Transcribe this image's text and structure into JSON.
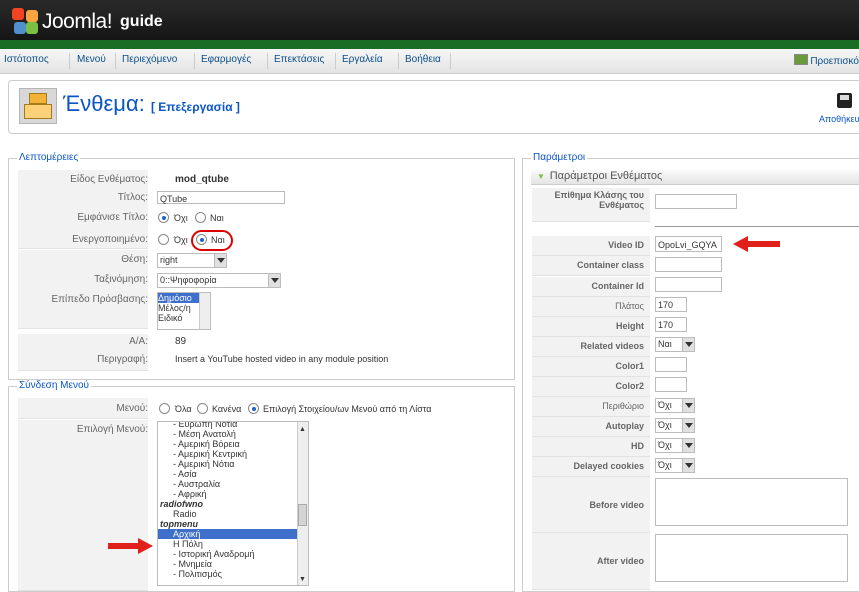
{
  "app": {
    "logo_text": "Joomla!",
    "site_name": "guide"
  },
  "menu": {
    "items": [
      "Ιστότοπος",
      "Μενού",
      "Περιεχόμενο",
      "Εφαρμογές",
      "Επεκτάσεις",
      "Εργαλεία",
      "Βοήθεια"
    ],
    "preview": "Προεπισκό"
  },
  "header": {
    "title": "Ένθεμα:",
    "subtitle": "[ Επεξεργασία ]",
    "save_label": "Αποθήκευ"
  },
  "details": {
    "legend": "Λεπτομέρειες",
    "type_label": "Είδος Ενθέματος:",
    "type_value": "mod_qtube",
    "title_label": "Τίτλος:",
    "title_value": "QTube",
    "show_title_label": "Εμφάνισε Τίτλο:",
    "show_title_options": [
      "Όχι",
      "Ναι"
    ],
    "show_title_selected": "Όχι",
    "enabled_label": "Ενεργοποιημένο:",
    "enabled_options": [
      "Όχι",
      "Ναι"
    ],
    "enabled_selected": "Ναι",
    "position_label": "Θέση:",
    "position_value": "right",
    "order_label": "Ταξινόμηση:",
    "order_value": "0::Ψηφοφορία",
    "access_label": "Επίπεδο Πρόσβασης:",
    "access_options": [
      "Δημόσιο",
      "Μέλος/η",
      "Ειδικό"
    ],
    "access_selected": "Δημόσιο",
    "id_label": "Α/Α:",
    "id_value": "89",
    "desc_label": "Περιγραφή:",
    "desc_value": "Insert a YouTube hosted video in any module position"
  },
  "menu_assignment": {
    "legend": "Σύνδεση Μενού",
    "menus_label": "Μενού:",
    "menus_options": [
      "Όλα",
      "Κανένα",
      "Επιλογή Στοιχείου/ων Μενού από τη Λίστα"
    ],
    "menus_selected": "Επιλογή Στοιχείου/ων Μενού από τη Λίστα",
    "select_label": "Επιλογή Μενού:",
    "list": [
      "- Ευρώπη Νότια",
      "- Μέση Ανατολή",
      "- Αμερική Βόρεια",
      "- Αμερική Κεντρική",
      "- Αμερική Νότια",
      "- Ασία",
      "- Αυστραλία",
      "- Αφρική",
      "radiofwno",
      "Radio",
      "topmenu",
      "Αρχική",
      "Η Πόλη",
      "- Ιστορική Αναδρομή",
      "- Μνημεία",
      "- Πολιτισμός"
    ],
    "list_selected": "Αρχική"
  },
  "params": {
    "legend": "Παράμετροι",
    "section_title": "Παράμετροι Ενθέματος",
    "rows": [
      {
        "label": "Επίθημα Κλάσης του Ενθέματος",
        "value": ""
      },
      {
        "label": "Video ID",
        "value": "OpoLvi_GQYA"
      },
      {
        "label": "Container class",
        "value": ""
      },
      {
        "label": "Container Id",
        "value": ""
      },
      {
        "label": "Πλάτος",
        "value": "170"
      },
      {
        "label": "Height",
        "value": "170"
      },
      {
        "label": "Related videos",
        "value": "Ναι"
      },
      {
        "label": "Color1",
        "value": ""
      },
      {
        "label": "Color2",
        "value": ""
      },
      {
        "label": "Περιθώριο",
        "value": "Όχι"
      },
      {
        "label": "Autoplay",
        "value": "Όχι"
      },
      {
        "label": "HD",
        "value": "Όχι"
      },
      {
        "label": "Delayed cookies",
        "value": "Όχι"
      },
      {
        "label": "Before video",
        "value": ""
      },
      {
        "label": "After video",
        "value": ""
      }
    ]
  },
  "colors": {
    "accent": "#0b55c4",
    "highlight": "#d00000",
    "brand_green": "#1a6d24"
  }
}
